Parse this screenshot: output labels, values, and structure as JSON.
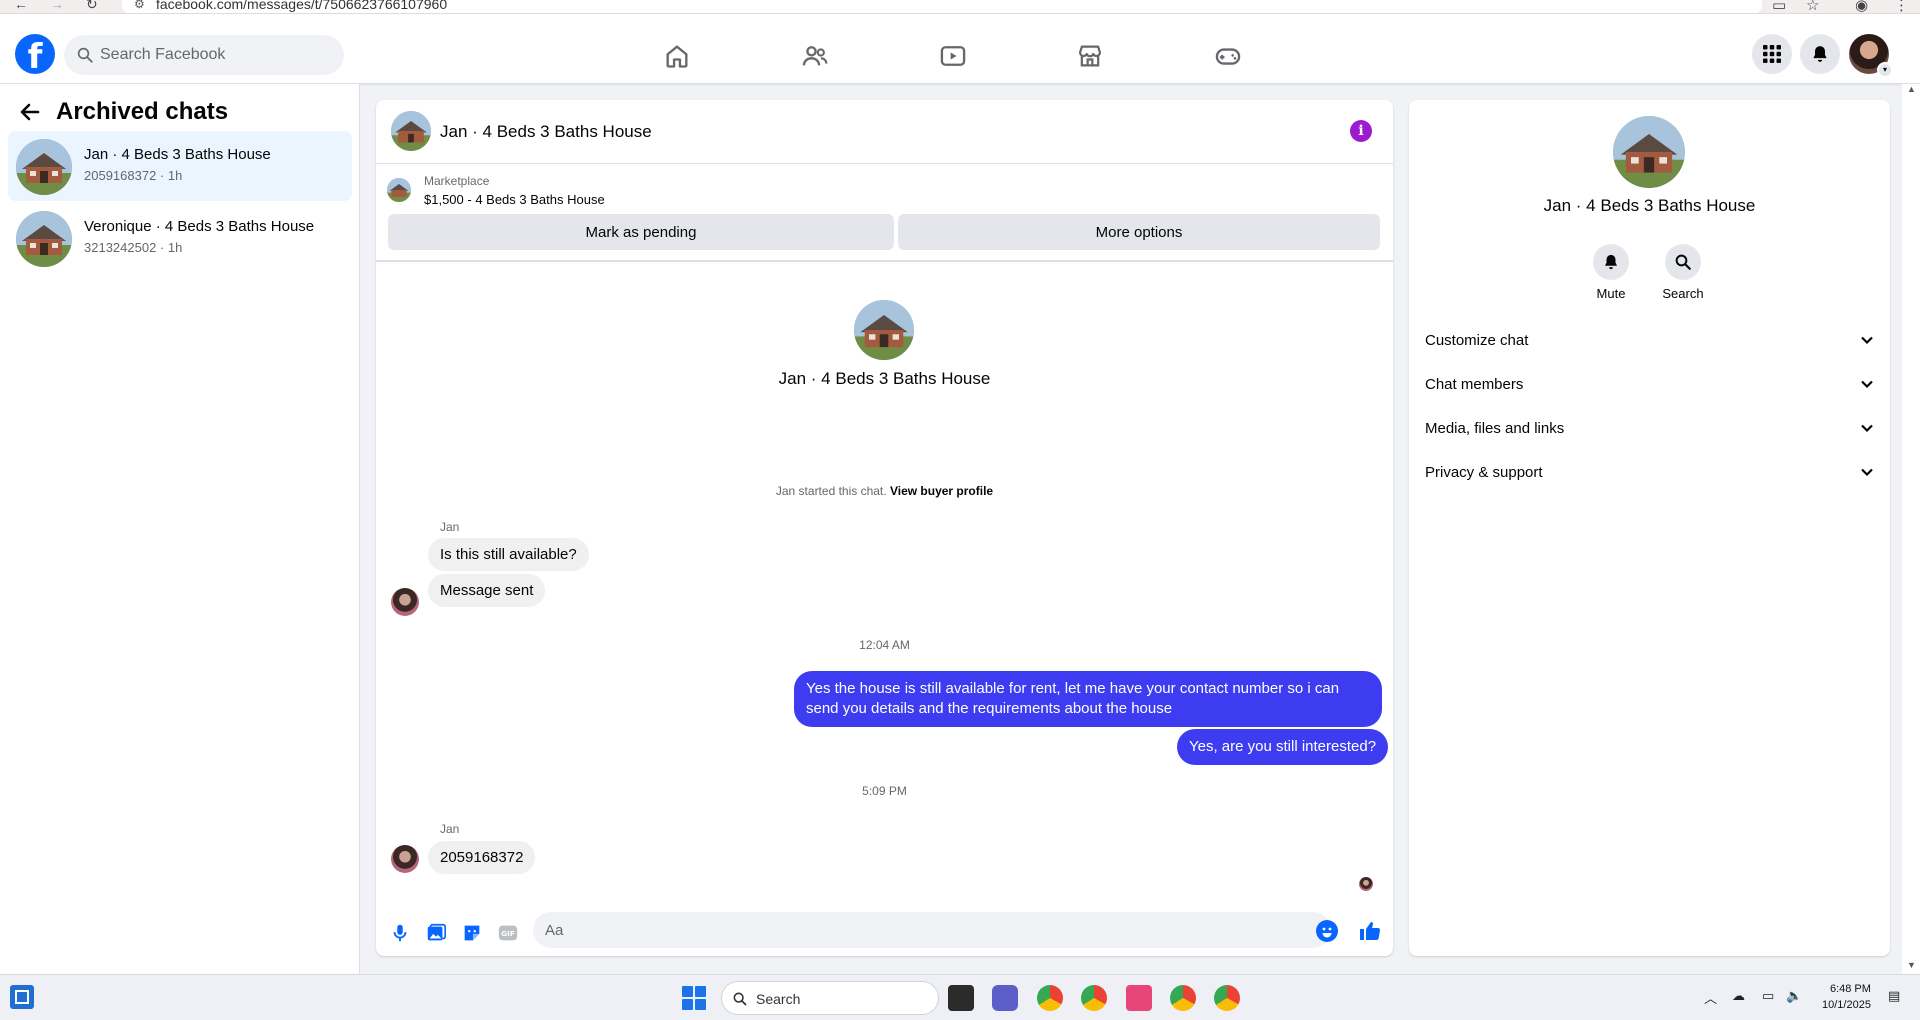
{
  "browser": {
    "url": "facebook.com/messages/t/7506623766107960"
  },
  "header": {
    "search_placeholder": "Search Facebook",
    "nav_icons": [
      "home-icon",
      "friends-icon",
      "video-icon",
      "marketplace-icon",
      "gaming-icon"
    ],
    "right_icons": [
      "menu-grid-icon",
      "notifications-icon",
      "profile-avatar"
    ],
    "accent_color": "#0866ff"
  },
  "sidebar": {
    "title": "Archived chats",
    "chats": [
      {
        "name": "Jan · 4 Beds 3 Baths House",
        "sub": "2059168372 · 1h",
        "active": true
      },
      {
        "name": "Veronique · 4 Beds 3 Baths House",
        "sub": "3213242502 · 1h",
        "active": false
      }
    ]
  },
  "chat": {
    "title": "Jan · 4 Beds 3 Baths House",
    "marketplace_label": "Marketplace",
    "marketplace_item": "$1,500 - 4 Beds 3 Baths House",
    "mark_pending_label": "Mark as pending",
    "more_options_label": "More options",
    "intro_name": "Jan · 4 Beds 3 Baths House",
    "started_text": "Jan started this chat.",
    "view_profile_label": "View buyer profile",
    "messages": [
      {
        "sender": "Jan",
        "text": "Is this still available?"
      },
      {
        "text": "Message sent"
      }
    ],
    "time_1": "12:04 AM",
    "out_messages": [
      "Yes the house is still available for rent, let me have your contact number so i can send you details and the requirements about the house",
      "Yes, are you still interested?"
    ],
    "time_2": "5:09 PM",
    "reply_sender": "Jan",
    "reply_text": "2059168372",
    "composer_placeholder": "Aa",
    "outgoing_color": "#3d3cf1"
  },
  "right_panel": {
    "name": "Jan · 4 Beds 3 Baths House",
    "mute_label": "Mute",
    "search_label": "Search",
    "sections": [
      "Customize chat",
      "Chat members",
      "Media, files and links",
      "Privacy & support"
    ]
  },
  "taskbar": {
    "search_label": "Search",
    "time": "6:48 PM",
    "date": "10/1/2025"
  }
}
